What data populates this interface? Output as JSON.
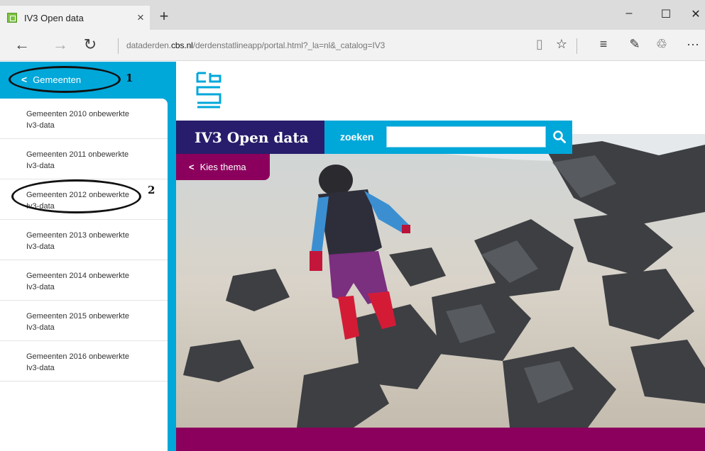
{
  "browser": {
    "tab_title": "IV3 Open data",
    "tab_close": "×",
    "new_tab": "+",
    "minimize": "–",
    "maximize": "☐",
    "close": "✕",
    "back": "←",
    "forward": "→",
    "refresh": "↻",
    "url_prefix": "dataderden.",
    "url_domain": "cbs.nl",
    "url_suffix": "/derdenstatlineapp/portal.html?_la=nl&_catalog=IV3",
    "reading_view": "▯",
    "favorite": "☆",
    "hub": "≡",
    "note": "✎",
    "share": "♲",
    "more": "···"
  },
  "sidebar": {
    "back_label": "Gemeenten",
    "marker_1": "1",
    "marker_2": "2",
    "items": [
      {
        "line1": "Gemeenten 2010 onbewerkte",
        "line2": "Iv3-data"
      },
      {
        "line1": "Gemeenten 2011 onbewerkte",
        "line2": "Iv3-data"
      },
      {
        "line1": "Gemeenten 2012 onbewerkte",
        "line2": "Iv3-data"
      },
      {
        "line1": "Gemeenten 2013 onbewerkte",
        "line2": "Iv3-data"
      },
      {
        "line1": "Gemeenten 2014 onbewerkte",
        "line2": "Iv3-data"
      },
      {
        "line1": "Gemeenten 2015 onbewerkte",
        "line2": "Iv3-data"
      },
      {
        "line1": "Gemeenten 2016 onbewerkte",
        "line2": "Iv3-data"
      }
    ]
  },
  "header": {
    "brand": "IV3 Open data",
    "search_label": "zoeken",
    "search_value": "",
    "theme_button": "Kies thema"
  },
  "colors": {
    "cbs_blue": "#00a7d9",
    "brand_navy": "#271d6c",
    "theme_purple": "#8b005d"
  }
}
